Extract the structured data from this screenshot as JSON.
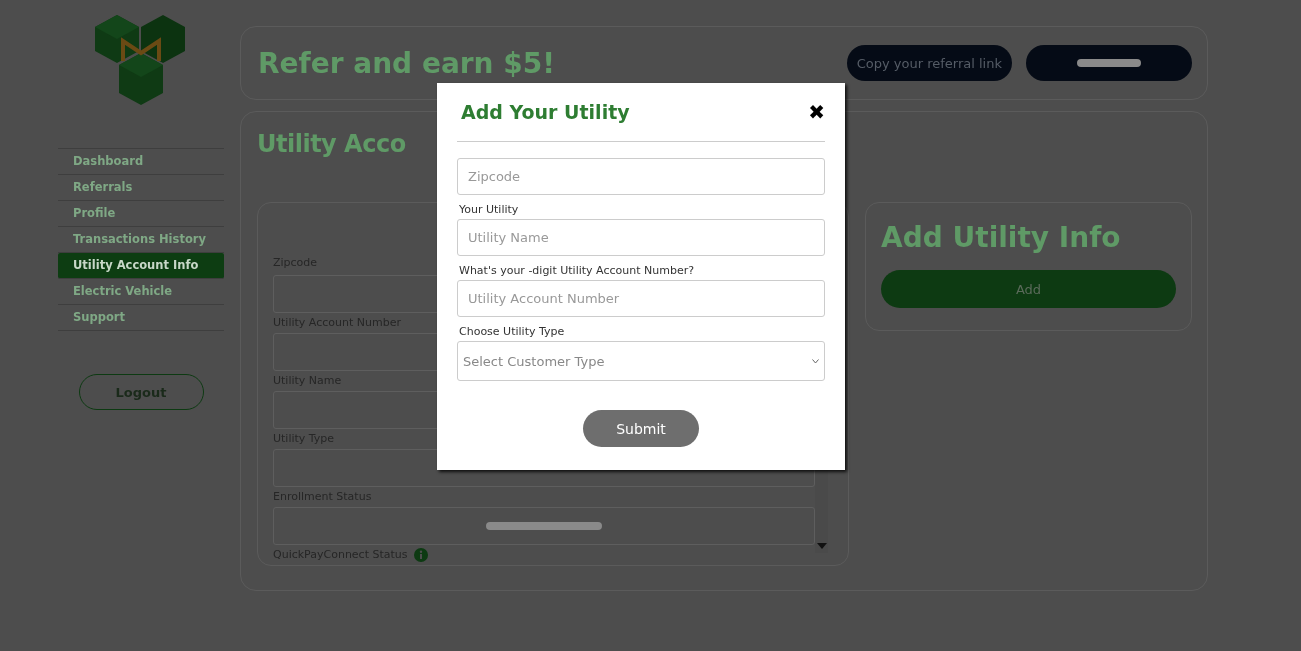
{
  "sidebar": {
    "items": [
      {
        "label": "Dashboard",
        "selected": false
      },
      {
        "label": "Referrals",
        "selected": false
      },
      {
        "label": "Profile",
        "selected": false
      },
      {
        "label": "Transactions History",
        "selected": false
      },
      {
        "label": "Utility Account Info",
        "selected": true
      },
      {
        "label": "Electric Vehicle",
        "selected": false
      },
      {
        "label": "Support",
        "selected": false
      }
    ],
    "logout": "Logout"
  },
  "referral": {
    "title": "Refer and earn $5!",
    "copy_button": "Copy your referral link"
  },
  "utility_page": {
    "title": "Utility Acco",
    "fields": [
      {
        "label": "Zipcode"
      },
      {
        "label": "Utility Account Number"
      },
      {
        "label": "Utility Name"
      },
      {
        "label": "Utility Type"
      },
      {
        "label": "Enrollment Status",
        "redacted": true
      }
    ],
    "last_label": "QuickPayConnect Status"
  },
  "add_card": {
    "title": "Add Utility Info",
    "button": "Add"
  },
  "modal": {
    "title": "Add Your Utility",
    "close": "✖",
    "zipcode": {
      "placeholder": "Zipcode"
    },
    "utility_label": "Your Utility",
    "utility": {
      "placeholder": "Utility Name"
    },
    "account_label": "What's your -digit Utility Account Number?",
    "account": {
      "placeholder": "Utility Account Number"
    },
    "type_label": "Choose Utility Type",
    "type_select": {
      "placeholder": "Select Customer Type"
    },
    "submit": "Submit"
  }
}
